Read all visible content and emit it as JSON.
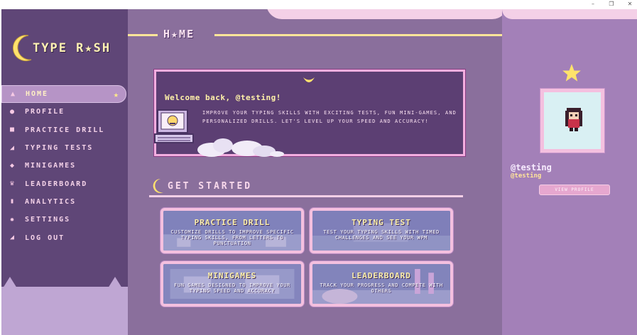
{
  "window": {
    "controls": [
      "–",
      "❐",
      "✕"
    ]
  },
  "app": {
    "logo_text": "TYPE R★SH"
  },
  "sidebar": {
    "items": [
      {
        "label": "HOME",
        "icon": "home-icon",
        "glyph": "▲",
        "active": true
      },
      {
        "label": "PROFILE",
        "icon": "user-icon",
        "glyph": "●"
      },
      {
        "label": "PRACTICE DRILL",
        "icon": "book-icon",
        "glyph": "■"
      },
      {
        "label": "TYPING TESTS",
        "icon": "send-icon",
        "glyph": "◢"
      },
      {
        "label": "MINIGAMES",
        "icon": "gamepad-icon",
        "glyph": "◆"
      },
      {
        "label": "LEADERBOARD",
        "icon": "trophy-icon",
        "glyph": "♛"
      },
      {
        "label": "ANALYTICS",
        "icon": "chart-icon",
        "glyph": "▮"
      },
      {
        "label": "SETTINGS",
        "icon": "gear-icon",
        "glyph": "✹"
      },
      {
        "label": "LOG OUT",
        "icon": "logout-icon",
        "glyph": "◢"
      }
    ],
    "active_star": "★"
  },
  "main": {
    "title": "H★ME",
    "welcome": {
      "title": "Welcome back, @testing!",
      "body": "IMPROVE YOUR TYPING SKILLS WITH EXCITING TESTS, FUN MINI-GAMES, AND PERSONALIZED DRILLS. LET'S LEVEL UP YOUR SPEED AND ACCURACY!"
    },
    "get_started": {
      "title": "GET STARTED"
    },
    "cards": [
      {
        "title": "PRACTICE DRILL",
        "desc": "CUSTOMIZE DRILLS TO IMPROVE SPECIFIC TYPING SKILLS, FROM LETTERS TO PUNCTUATION"
      },
      {
        "title": "TYPING TEST",
        "desc": "TEST YOUR TYPING SKILLS WITH TIMED CHALLENGES AND SEE YOUR WPM"
      },
      {
        "title": "MINIGAMES",
        "desc": "FUN GAMES DESIGNED TO IMPROVE YOUR TYPING SPEED AND ACCURACY"
      },
      {
        "title": "LEADERBOARD",
        "desc": "TRACK YOUR PROGRESS AND COMPETE WITH OTHERS"
      }
    ]
  },
  "profile": {
    "name": "@testing",
    "handle": "@testing",
    "view_button": "VIEW PROFILE"
  },
  "colors": {
    "sidebar_bg": "#5f4677",
    "main_bg": "#8a6f9c",
    "accent_yellow": "#ffe699",
    "accent_pink": "#f4d0e7"
  }
}
